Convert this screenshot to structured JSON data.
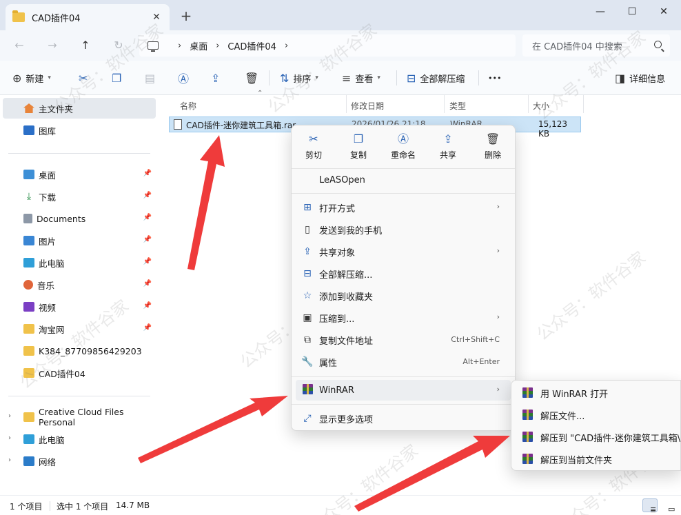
{
  "window": {
    "tab_title": "CAD插件04",
    "tab_close": "✕",
    "new_tab": "+",
    "minimize": "—",
    "maximize": "☐",
    "close": "✕"
  },
  "nav": {
    "back": "←",
    "forward": "→",
    "up": "↑",
    "refresh": "↻"
  },
  "address": {
    "sep": "›",
    "crumbs": [
      "桌面",
      "CAD插件04"
    ]
  },
  "search": {
    "placeholder": "在 CAD插件04 中搜索"
  },
  "toolbar": {
    "new_label": "新建",
    "sort_label": "排序",
    "view_label": "查看",
    "extract_all_label": "全部解压缩",
    "more_label": "•••",
    "details_label": "详细信息"
  },
  "sidebar": {
    "items": [
      {
        "label": "主文件夹"
      },
      {
        "label": "图库"
      },
      {
        "label": "桌面"
      },
      {
        "label": "下载"
      },
      {
        "label": "Documents"
      },
      {
        "label": "图片"
      },
      {
        "label": "此电脑"
      },
      {
        "label": "音乐"
      },
      {
        "label": "视频"
      },
      {
        "label": "淘宝网"
      },
      {
        "label": "K384_87709856429203"
      },
      {
        "label": "CAD插件04"
      },
      {
        "label": "Creative Cloud Files Personal"
      },
      {
        "label": "此电脑"
      },
      {
        "label": "网络"
      }
    ]
  },
  "filelist": {
    "columns": [
      "名称",
      "修改日期",
      "类型",
      "大小"
    ],
    "rows": [
      {
        "name": "CAD插件-迷你建筑工具箱.rar",
        "modified": "2026/01/26 21:18",
        "type": "WinRAR",
        "size": "15,123 KB"
      }
    ]
  },
  "context_menu": {
    "quick_actions": [
      "剪切",
      "复制",
      "重命名",
      "共享",
      "删除"
    ],
    "items": [
      {
        "label": "LeASOpen"
      },
      {
        "label": "打开方式"
      },
      {
        "label": "发送到我的手机"
      },
      {
        "label": "共享对象"
      },
      {
        "label": "全部解压缩..."
      },
      {
        "label": "添加到收藏夹"
      },
      {
        "label": "压缩到..."
      },
      {
        "label": "复制文件地址",
        "shortcut": "Ctrl+Shift+C"
      },
      {
        "label": "属性",
        "shortcut": "Alt+Enter"
      },
      {
        "label": "WinRAR"
      },
      {
        "label": "显示更多选项"
      }
    ]
  },
  "winrar_submenu": {
    "items": [
      {
        "label": "用 WinRAR 打开"
      },
      {
        "label": "解压文件..."
      },
      {
        "label": "解压到 \"CAD插件-迷你建筑工具箱\\\""
      },
      {
        "label": "解压到当前文件夹"
      }
    ]
  },
  "status": {
    "item_count": "1 个项目",
    "selected": "选中 1 个项目",
    "size": "14.7 MB"
  },
  "watermark": "公众号：软件谷家",
  "colors": {
    "accent": "#2a63b5",
    "selection": "#cce4f7",
    "arrow": "#ef3b3b"
  }
}
